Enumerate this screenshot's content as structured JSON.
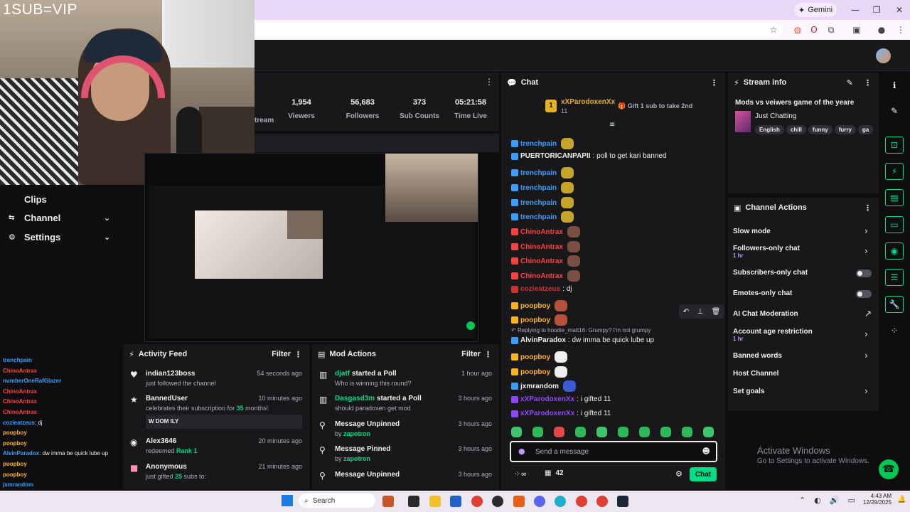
{
  "overlay": {
    "webcam_text": "1SUB=VIP"
  },
  "browser": {
    "gemini_label": "Gemini",
    "minimize": "—",
    "maximize": "❐",
    "close": "✕",
    "icons": [
      "star-icon",
      "extension-icon",
      "opera-icon",
      "puzzle-icon",
      "screenshot-icon",
      "profile-icon",
      "menu-icon"
    ]
  },
  "leftnav": {
    "items": [
      {
        "label": "Clips",
        "icon": ""
      },
      {
        "label": "Channel",
        "icon": "⇆",
        "chev": "⌄"
      },
      {
        "label": "Settings",
        "icon": "⚙",
        "chev": "⌄"
      }
    ]
  },
  "minichat": [
    {
      "name": "trenchpain",
      "text": ""
    },
    {
      "name": "ChinoAntrax",
      "text": ""
    },
    {
      "name": "numberOneRafGlazer",
      "text": ""
    },
    {
      "name": "ChinoAntrax",
      "text": ""
    },
    {
      "name": "ChinoAntrax",
      "text": ""
    },
    {
      "name": "ChinoAntrax",
      "text": ""
    },
    {
      "name": "cozieatzeus",
      "text": ": dj"
    },
    {
      "name": "poopboy",
      "text": ""
    },
    {
      "name": "poopboy",
      "text": ""
    },
    {
      "name": "AlvinParadox",
      "text": ": dw imma be quick lube up"
    },
    {
      "name": "poopboy",
      "text": ""
    },
    {
      "name": "poopboy",
      "text": ""
    },
    {
      "name": "jxmrandom",
      "text": ""
    },
    {
      "name": "xXParodoxenXx",
      "text": ": i gifted 11"
    },
    {
      "name": "xXParodoxenXx",
      "text": ": i gifted 11"
    }
  ],
  "stats": [
    {
      "value": "1,954",
      "label": "Viewers"
    },
    {
      "value": "56,683",
      "label": "Followers"
    },
    {
      "value": "373",
      "label": "Sub Counts"
    },
    {
      "value": "05:21:58",
      "label": "Time Live"
    }
  ],
  "stats_partial_label": "tream",
  "activity_feed": {
    "title": "Activity Feed",
    "filter": "Filter",
    "items": [
      {
        "icon": "heart-icon",
        "glyph": "♥",
        "name": "indian123boss",
        "sub": "just followed the channel",
        "time": "54 seconds ago"
      },
      {
        "icon": "star-icon",
        "glyph": "★",
        "name": "BannedUser",
        "sub_pre": "celebrates their subscription for ",
        "sub_num": "35",
        "sub_post": " months!",
        "quote": "W DOM ILY",
        "time": "10 minutes ago"
      },
      {
        "icon": "points-icon",
        "glyph": "◉",
        "name": "Alex3646",
        "sub_pre": "redeemed ",
        "sub_num": "Rank 1",
        "time": "20 minutes ago"
      },
      {
        "icon": "gift-icon",
        "glyph": "🎁",
        "name": "Anonymous",
        "sub_pre": "just gifted ",
        "sub_num": "25",
        "sub_post": " subs to:",
        "time": "21 minutes ago"
      }
    ]
  },
  "mod_actions": {
    "title": "Mod Actions",
    "filter": "Filter",
    "items": [
      {
        "icon": "poll-icon",
        "glyph": "▥",
        "name": "djatf",
        "action": " started a Poll",
        "sub": "Who is winning this round?",
        "time": "1 hour ago"
      },
      {
        "icon": "poll-icon",
        "glyph": "▥",
        "name": "Dasgasd3m",
        "action": " started a Poll",
        "sub": "should paradoxen get mod",
        "time": "3 hours ago"
      },
      {
        "icon": "unpin-icon",
        "glyph": "⚲",
        "name": "Message Unpinned",
        "action": "",
        "sub_pre": "by ",
        "by": "zapotron",
        "time": "3 hours ago"
      },
      {
        "icon": "pin-icon",
        "glyph": "⚲",
        "name": "Message Pinned",
        "action": "",
        "sub_pre": "by ",
        "by": "zapotron",
        "time": "3 hours ago"
      },
      {
        "icon": "unpin-icon",
        "glyph": "⚲",
        "name": "Message Unpinned",
        "action": "",
        "sub_pre": "by ",
        "by": "",
        "time": "3 hours ago"
      }
    ]
  },
  "chat": {
    "title": "Chat",
    "leader_rank": "1",
    "leader_name": "xXParodoxenXx",
    "leader_count": "11",
    "gift_cta": "Gift 1 sub to take 2nd",
    "messages": [
      {
        "name": "trenchpain",
        "color": "#3a9eff",
        "text": "",
        "emote": "#c6a42a"
      },
      {
        "name": "PUERTORICANPAPII",
        "color": "#efeff1",
        "text": ": poll to get kari banned",
        "emote": ""
      },
      {
        "name": "trenchpain",
        "color": "#3a9eff",
        "text": "",
        "emote": "#c6a42a"
      },
      {
        "name": "trenchpain",
        "color": "#3a9eff",
        "text": "",
        "emote": "#c6a42a"
      },
      {
        "name": "trenchpain",
        "color": "#3a9eff",
        "text": "",
        "emote": "#c6a42a"
      },
      {
        "name": "trenchpain",
        "color": "#3a9eff",
        "text": "",
        "emote": "#c6a42a"
      },
      {
        "name": "ChinoAntrax",
        "color": "#ff4040",
        "text": "",
        "emote": "#7a4e40"
      },
      {
        "name": "ChinoAntrax",
        "color": "#ff4040",
        "text": "",
        "emote": "#7a4e40"
      },
      {
        "name": "ChinoAntrax",
        "color": "#ff4040",
        "text": "",
        "emote": "#7a4e40"
      },
      {
        "name": "ChinoAntrax",
        "color": "#ff4040",
        "text": "",
        "emote": "#7a4e40"
      },
      {
        "name": "cozieatzeus",
        "color": "#d03030",
        "text": ": dj",
        "emote": ""
      },
      {
        "name": "poopboy",
        "color": "#ffb31a",
        "text": "",
        "emote": "#b5513b"
      },
      {
        "name": "poopboy",
        "color": "#ffb31a",
        "text": "",
        "emote": "#b5513b"
      },
      {
        "name": "AlvinParadox",
        "color": "#efeff1",
        "text": ": dw imma be quick lube up",
        "emote": ""
      },
      {
        "name": "poopboy",
        "color": "#ffb31a",
        "text": "",
        "emote": "#efefef"
      },
      {
        "name": "poopboy",
        "color": "#ffb31a",
        "text": "",
        "emote": "#efefef"
      },
      {
        "name": "jxmrandom",
        "color": "#efeff1",
        "text": "",
        "emote": "#3b5bd6"
      },
      {
        "name": "xXParodoxenXx",
        "color": "#9147ff",
        "text": ": i gifted 11",
        "emote": ""
      },
      {
        "name": "xXParodoxenXx",
        "color": "#9147ff",
        "text": ": i gifted 11",
        "emote": ""
      }
    ],
    "reply_note": "Replying to hoodie_matt16: Grumpy? I'm not grumpy",
    "input_placeholder": "Send a message",
    "points": "42",
    "chat_button": "Chat"
  },
  "stream_info": {
    "title": "Stream info",
    "stream_title": "Mods vs veiwers game of the yeare",
    "category": "Just Chatting",
    "tags": [
      "English",
      "chill",
      "funny",
      "furry",
      "ga"
    ]
  },
  "channel_actions": {
    "title": "Channel Actions",
    "items": [
      {
        "label": "Slow mode",
        "sub": "",
        "control": "arrow"
      },
      {
        "label": "Followers-only chat",
        "sub": "1 hr",
        "control": "arrow"
      },
      {
        "label": "Subscribers-only chat",
        "sub": "",
        "control": "toggle"
      },
      {
        "label": "Emotes-only chat",
        "sub": "",
        "control": "toggle"
      },
      {
        "label": "AI Chat Moderation",
        "sub": "",
        "control": "external"
      },
      {
        "label": "Account age restriction",
        "sub": "1 hr",
        "control": "arrow"
      },
      {
        "label": "Banned words",
        "sub": "",
        "control": "arrow"
      },
      {
        "label": "Host Channel",
        "sub": "",
        "control": "none"
      },
      {
        "label": "Set goals",
        "sub": "",
        "control": "arrow"
      }
    ]
  },
  "watermark": {
    "title": "Activate Windows",
    "sub": "Go to Settings to activate Windows."
  },
  "taskbar": {
    "search": "Search",
    "time": "4:43 AM",
    "date": "12/29/2025"
  },
  "colors": {
    "accent": "#9147ff",
    "chat_button": "#00db84",
    "panel": "#18181b",
    "background": "#0e0e10"
  }
}
